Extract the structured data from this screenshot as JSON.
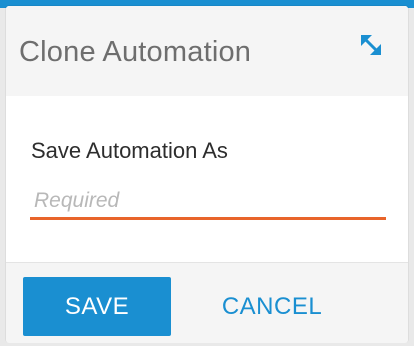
{
  "dialog": {
    "title": "Clone Automation",
    "expand_icon": "expand-diagonal-icon"
  },
  "form": {
    "label": "Save Automation As",
    "input_value": "",
    "input_placeholder": "Required"
  },
  "actions": {
    "save_label": "SAVE",
    "cancel_label": "CANCEL"
  },
  "colors": {
    "accent_blue": "#1a8fd1",
    "input_underline": "#e8642a",
    "title_text": "#6e6e6e",
    "header_bg": "#f5f5f5"
  }
}
